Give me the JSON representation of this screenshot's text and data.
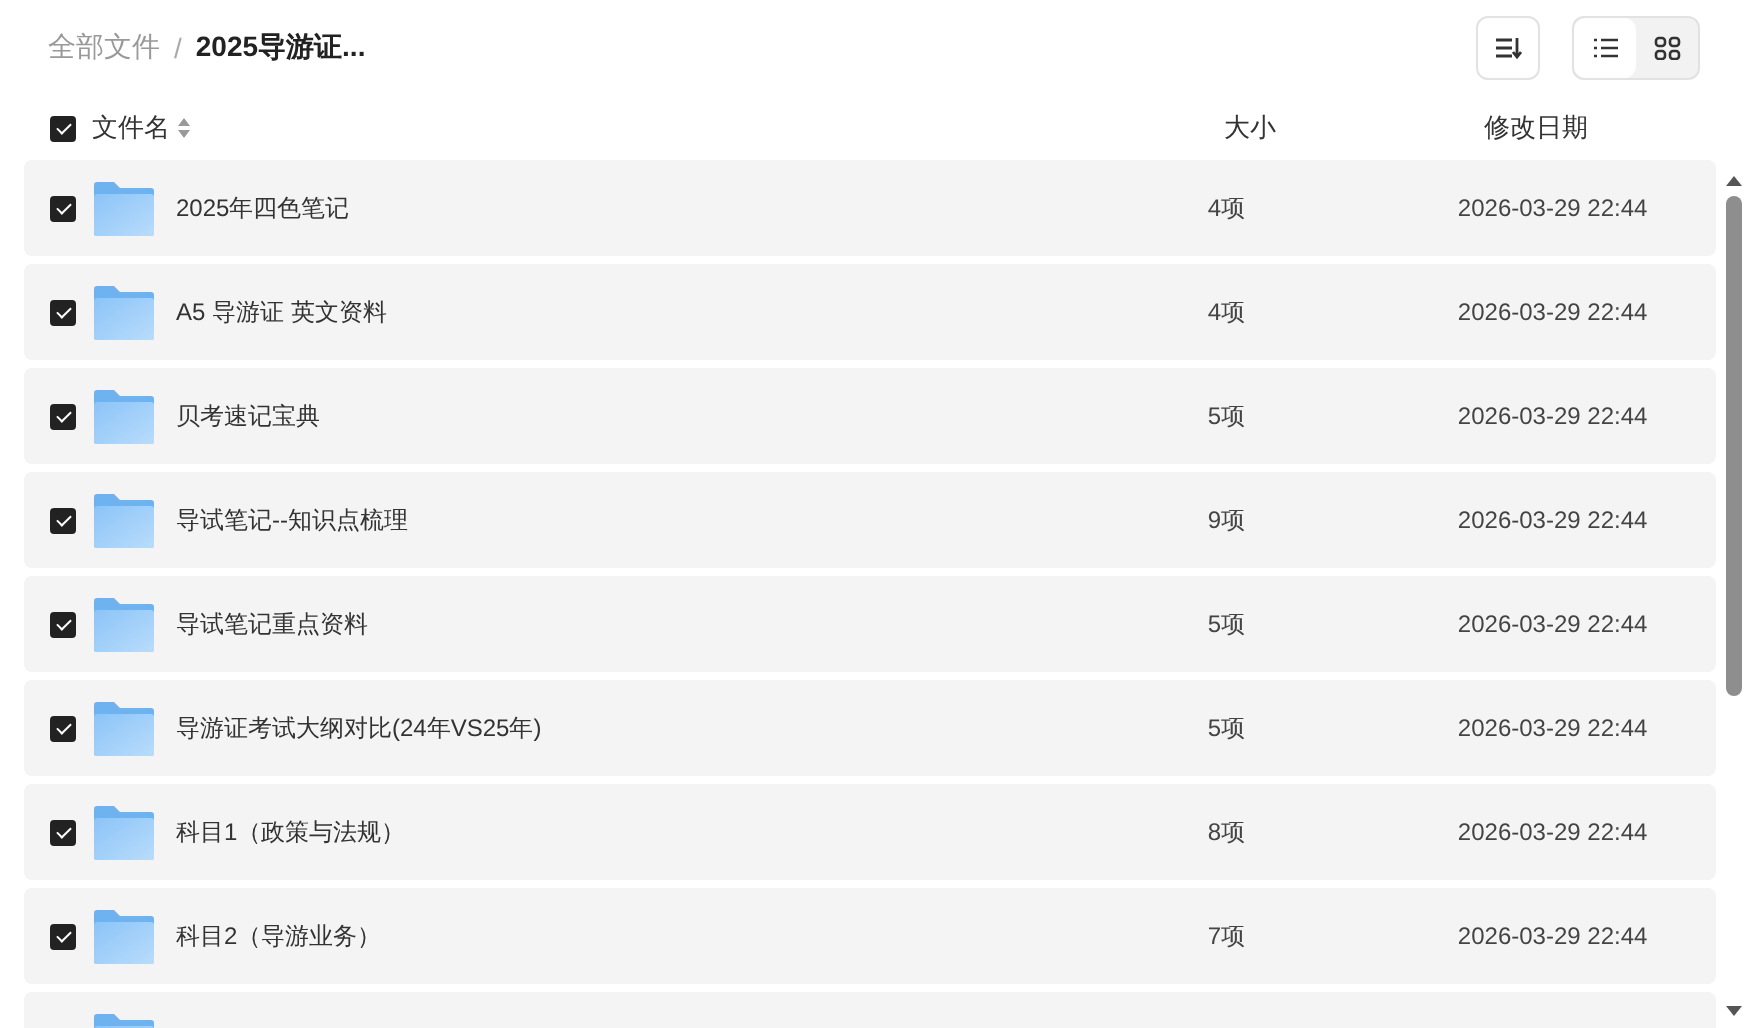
{
  "breadcrumb_separator": "/",
  "breadcrumb": [
    {
      "label": "全部文件",
      "current": false
    },
    {
      "label": "2025导游证...",
      "current": true
    }
  ],
  "view_modes": [
    {
      "kind": "list",
      "selected": true
    },
    {
      "kind": "grid",
      "selected": false
    }
  ],
  "header": {
    "checked": true,
    "name": "文件名",
    "size": "大小",
    "modified": "修改日期"
  },
  "rows": [
    {
      "checked": true,
      "name": "2025年四色笔记",
      "size": "4项",
      "modified": "2026-03-29 22:44"
    },
    {
      "checked": true,
      "name": "A5 导游证 英文资料",
      "size": "4项",
      "modified": "2026-03-29 22:44"
    },
    {
      "checked": true,
      "name": "贝考速记宝典",
      "size": "5项",
      "modified": "2026-03-29 22:44"
    },
    {
      "checked": true,
      "name": "导试笔记--知识点梳理",
      "size": "9项",
      "modified": "2026-03-29 22:44"
    },
    {
      "checked": true,
      "name": "导试笔记重点资料",
      "size": "5项",
      "modified": "2026-03-29 22:44"
    },
    {
      "checked": true,
      "name": "导游证考试大纲对比(24年VS25年)",
      "size": "5项",
      "modified": "2026-03-29 22:44"
    },
    {
      "checked": true,
      "name": "科目1（政策与法规）",
      "size": "8项",
      "modified": "2026-03-29 22:44"
    },
    {
      "checked": true,
      "name": "科目2（导游业务）",
      "size": "7项",
      "modified": "2026-03-29 22:44"
    },
    {}
  ]
}
